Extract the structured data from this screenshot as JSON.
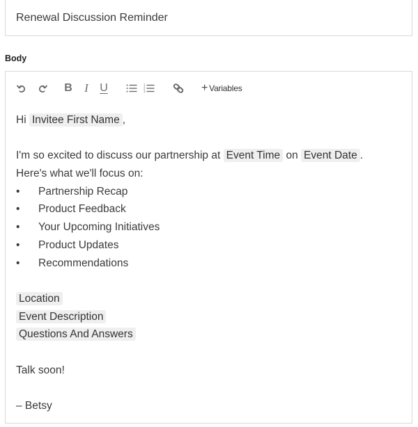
{
  "subject": {
    "value": "Renewal Discussion Reminder"
  },
  "body_label": "Body",
  "toolbar": {
    "undo_icon": "undo-icon",
    "redo_icon": "redo-icon",
    "bold_label": "B",
    "italic_label": "I",
    "underline_label": "U",
    "bullet_list_icon": "bullet-list-icon",
    "numbered_list_icon": "numbered-list-icon",
    "link_icon": "link-icon",
    "variables_plus": "+",
    "variables_label": "Variables"
  },
  "content": {
    "greeting_prefix": "Hi",
    "greeting_var": "Invitee First Name",
    "greeting_suffix": ",",
    "intro_text": "I'm so excited to discuss our partnership at",
    "intro_var_time": "Event Time",
    "intro_on": "on",
    "intro_var_date": "Event Date",
    "intro_end": ".",
    "focus_line": "Here's what we'll focus on:",
    "bullet_char": "•",
    "bullets": [
      "Partnership Recap",
      "Product Feedback",
      "Your Upcoming Initiatives",
      "Product Updates",
      "Recommendations"
    ],
    "variable_blocks": [
      "Location",
      "Event Description",
      "Questions And Answers"
    ],
    "closing": "Talk soon!",
    "signature": "– Betsy"
  }
}
